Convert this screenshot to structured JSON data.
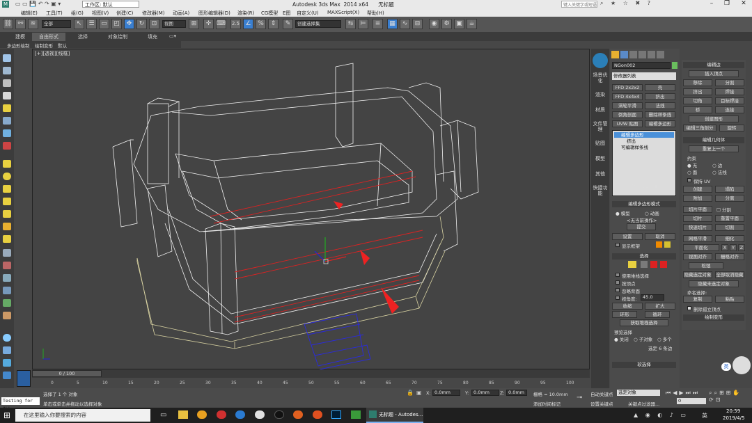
{
  "window": {
    "title": "Autodesk 3ds Max  2014 x64      无标题",
    "workspace": "工作区: 默认",
    "search_placeholder": "键入关键字或短语"
  },
  "menu": [
    "编辑(E)",
    "工具(T)",
    "组(G)",
    "视图(V)",
    "创建(C)",
    "修改器(M)",
    "动画(A)",
    "图形编辑器(D)",
    "渲染(R)",
    "CG模型",
    "E图",
    "自定义(U)",
    "MAXScript(X)",
    "帮助(H)"
  ],
  "toolbar": {
    "selection_filter": "全部",
    "view_dropdown": "视图",
    "snap_value": "2.5",
    "named_set": "创建选择集"
  },
  "ribbon": {
    "tabs": [
      "建模",
      "自由形式",
      "选择",
      "对象绘制",
      "填充"
    ],
    "active_tab": "自由形式",
    "sub": [
      "多边形绘制",
      "绘制变形",
      "默认"
    ]
  },
  "viewport": {
    "label": "[+][透视][线框]"
  },
  "command_tabs": [
    "场景优化",
    "渲染",
    "材质",
    "文件管理",
    "贴图",
    "模型",
    "其他",
    "快捷功能"
  ],
  "command_panel": {
    "object_name": "NGon002",
    "modifier_list": "修改器列表",
    "quick_buttons": [
      "FFD 2x2x2",
      "壳",
      "FFD 4x4x4",
      "挤出",
      "涡轮平滑",
      "法线",
      "倒角剖面",
      "删除样条线",
      "UVW 贴图",
      "编辑多边形"
    ],
    "stack": [
      "编辑多边形",
      "挤出",
      "可编辑样条线"
    ],
    "edit_poly_mode": {
      "title": "编辑多边形模式",
      "model": "模型",
      "animate": "动画",
      "no_op": "<无当前操作>",
      "commit": "提交",
      "settings": "设置",
      "cancel": "取消",
      "show_cage": "显示框架"
    },
    "selection": {
      "title": "选择",
      "by_vertex": "使用堆栈选择",
      "by_vertex2": "按顶点",
      "ignore_back": "忽略背面",
      "by_angle": "按角度:",
      "angle_value": "45.0",
      "shrink": "收缩",
      "grow": "扩大",
      "ring": "环形",
      "loop": "循环",
      "get_stack": "获取堆栈选择",
      "preview": "预览选择",
      "off": "关闭",
      "subobj": "子对象",
      "multi": "多个",
      "selected": "选定 6 条边"
    },
    "soft_sel": "软选择"
  },
  "edit_edges": {
    "title": "编辑边",
    "insert_vertex": "插入顶点",
    "remove": "移除",
    "split": "分割",
    "extrude": "挤出",
    "weld": "焊接",
    "chamfer": "切角",
    "target_weld": "目标焊接",
    "bridge": "桥",
    "connect": "连接",
    "create_shape": "创建图形",
    "edit_tri": "编辑三角剖分",
    "rotate": "旋转"
  },
  "edit_geometry": {
    "title": "编辑几何体",
    "repeat_last": "重复上一个",
    "constraints": "约束",
    "none": "无",
    "edge": "边",
    "face": "面",
    "normal": "法线",
    "preserve_uv": "保持 UV",
    "create": "创建",
    "collapse": "塌陷",
    "attach": "附加",
    "detach": "分离",
    "slice_plane": "切片平面",
    "split": "分割",
    "slice": "切片",
    "reset_plane": "重置平面",
    "quickslice": "快速切片",
    "cut": "切割",
    "meshsmooth": "网格平滑",
    "tessellate": "细化",
    "make_planar": "平面化",
    "x": "X",
    "y": "Y",
    "z": "Z",
    "view_align": "视图对齐",
    "grid_align": "栅格对齐",
    "relax": "松弛",
    "hide_sel": "隐藏选定对象",
    "unhide_all": "全部取消隐藏",
    "hide_unsel": "隐藏未选定对象",
    "named_sel": "命名选择:",
    "copy": "复制",
    "paste": "粘贴",
    "delete_iso": "删除孤立顶点",
    "paint": "绘制变形"
  },
  "timeline": {
    "frame": "0 / 100",
    "ticks": [
      "0",
      "5",
      "10",
      "15",
      "20",
      "25",
      "30",
      "35",
      "40",
      "45",
      "50",
      "55",
      "60",
      "65",
      "70",
      "75",
      "80",
      "85",
      "90",
      "95",
      "100"
    ]
  },
  "status": {
    "script_label": "Testing for ALL",
    "selected": "选择了 1 个 对象",
    "hint": "单击或单击并拖动以选择对象",
    "x_label": "X:",
    "x": "0.0mm",
    "y_label": "Y:",
    "y": "0.0mm",
    "z_label": "Z:",
    "z": "0.0mm",
    "grid": "栅格 = 10.0mm",
    "add_time_tag": "添加时间标记",
    "auto_key": "自动关键点",
    "set_key": "设置关键点",
    "key_filter": "关键点过滤器...",
    "sel_obj": "选定对象",
    "frame_field": "0"
  },
  "taskbar": {
    "search": "在这里输入你要搜索的内容",
    "app": "无标题 - Autodes...",
    "time": "20:59",
    "date": "2019/4/5",
    "ime": "英"
  }
}
